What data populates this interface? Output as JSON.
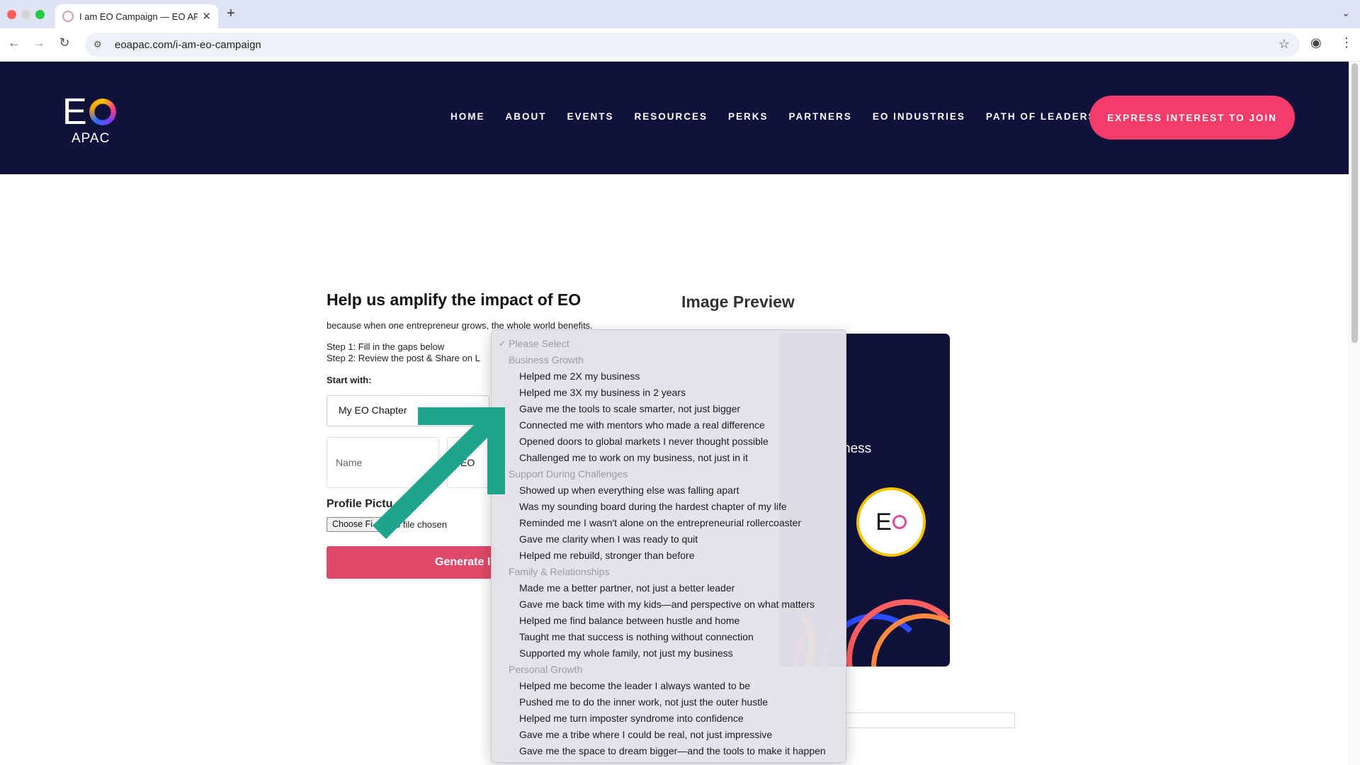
{
  "browser": {
    "tab_title": "I am EO Campaign — EO APAC",
    "url": "eoapac.com/i-am-eo-campaign"
  },
  "header": {
    "logo_main": "E",
    "logo_sub": "APAC",
    "nav": [
      "HOME",
      "ABOUT",
      "EVENTS",
      "RESOURCES",
      "PERKS",
      "PARTNERS",
      "EO INDUSTRIES",
      "PATH OF LEADERSHIP"
    ],
    "cta": "EXPRESS INTEREST TO JOIN"
  },
  "form": {
    "heading": "Help us amplify the impact of EO",
    "subheading": "because when one entrepreneur grows, the whole world benefits.",
    "step1": "Step 1: Fill in the gaps below",
    "step2": "Step 2: Review the post & Share on L",
    "start_with": "Start with:",
    "chapter_value": "My EO Chapter",
    "name_placeholder": "Name",
    "eo_field_value": "EO",
    "profile_label": "Profile Pictu",
    "file_button": "Choose Fi",
    "file_status": "o file chosen",
    "generate_button": "Generate I"
  },
  "preview": {
    "heading": "Image Preview",
    "card_text": "ness",
    "badge_text": "E"
  },
  "dropdown": {
    "selected": "Please Select",
    "groups": [
      {
        "label": "Business Growth",
        "options": [
          "Helped me 2X my business",
          "Helped me 3X my business in 2 years",
          "Gave me the tools to scale smarter, not just bigger",
          "Connected me with mentors who made a real difference",
          "Opened doors to global markets I never thought possible",
          "Challenged me to work on my business, not just in it"
        ]
      },
      {
        "label": "Support During Challenges",
        "options": [
          "Showed up when everything else was falling apart",
          "Was my sounding board during the hardest chapter of my life",
          "Reminded me I wasn't alone on the entrepreneurial rollercoaster",
          "Gave me clarity when I was ready to quit",
          "Helped me rebuild, stronger than before"
        ]
      },
      {
        "label": "Family & Relationships",
        "options": [
          "Made me a better partner, not just a better leader",
          "Gave me back time with my kids—and perspective on what matters",
          "Helped me find balance between hustle and home",
          "Taught me that success is nothing without connection",
          "Supported my whole family, not just my business"
        ]
      },
      {
        "label": "Personal Growth",
        "options": [
          "Helped me become the leader I always wanted to be",
          "Pushed me to do the inner work, not just the outer hustle",
          "Helped me turn imposter syndrome into confidence",
          "Gave me a tribe where I could be real, not just impressive",
          "Gave me the space to dream bigger—and the tools to make it happen"
        ]
      }
    ]
  },
  "colors": {
    "header_bg": "#10123b",
    "cta_bg": "#f23c6a",
    "generate_bg": "#e04a6a",
    "arrow": "#1fa58b"
  },
  "icons": [
    "back-arrow-icon",
    "forward-arrow-icon",
    "reload-icon",
    "site-settings-icon",
    "bookmark-star-icon",
    "profile-icon",
    "menu-dots-icon",
    "checkmark-icon",
    "pointer-arrow-icon"
  ]
}
